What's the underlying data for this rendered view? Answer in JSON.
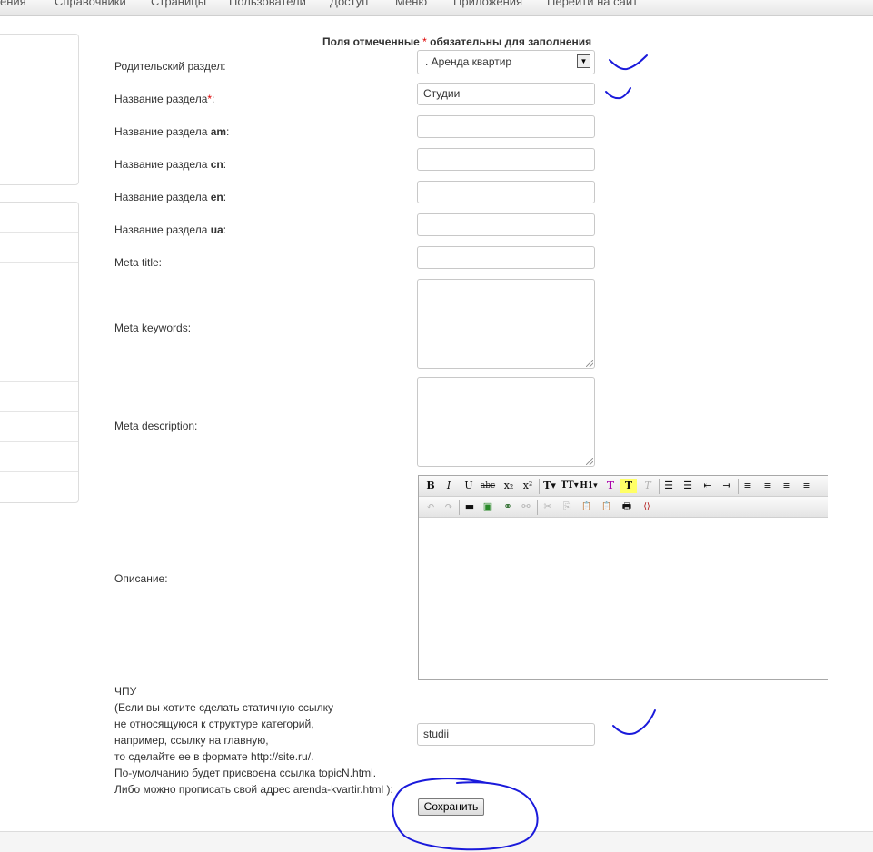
{
  "topnav": {
    "items": [
      "ения",
      "Справочники",
      "Страницы",
      "Пользователи",
      "Доступ",
      "Меню",
      "Приложения",
      "Перейти на сайт"
    ]
  },
  "form": {
    "required_note_prefix": "Поля отмеченные ",
    "required_note_star": "*",
    "required_note_suffix": " обязательны для заполнения",
    "parent_label": "Родительский раздел:",
    "parent_value": ". Аренда квартир",
    "name_label": "Название раздела",
    "name_star": "*",
    "name_colon": ":",
    "name_value": "Студии",
    "name_am_prefix": "Название раздела ",
    "name_am_lang": "am",
    "name_cn_prefix": "Название раздела ",
    "name_cn_lang": "cn",
    "name_en_prefix": "Название раздела ",
    "name_en_lang": "en",
    "name_ua_prefix": "Название раздела ",
    "name_ua_lang": "ua",
    "lang_colon": ":",
    "meta_title_label": "Meta title:",
    "meta_keywords_label": "Meta keywords:",
    "meta_description_label": "Meta description:",
    "description_label": "Описание:",
    "chpu_lines": [
      "ЧПУ",
      "(Если вы хотите сделать статичную ссылку",
      "не относящуюся к структуре категорий,",
      "например, ссылку на главную,",
      "то сделайте ее в формате http://site.ru/.",
      "По-умолчанию будет присвоена ссылка topicN.html.",
      "Либо можно прописать свой адрес arenda-kvartir.html ):"
    ],
    "chpu_value": "studii",
    "save_label": "Сохранить"
  },
  "editor": {
    "row1": [
      "B",
      "I",
      "U",
      "abc",
      "x₂",
      "x²",
      "T▾",
      "TT▾",
      "H1▾",
      "T",
      "T",
      "T",
      "☰",
      "☰",
      "⇤",
      "⇥",
      "≡",
      "≡",
      "≡",
      "≡"
    ],
    "row2": [
      "↶",
      "↷",
      "▬",
      "▣",
      "⚭",
      "⚯",
      "✂",
      "⎘",
      "📋",
      "📋",
      "🖶",
      "⟨⟩"
    ]
  },
  "colors": {
    "required_star": "#dd0000",
    "annotation_ink": "#1a1adb"
  }
}
